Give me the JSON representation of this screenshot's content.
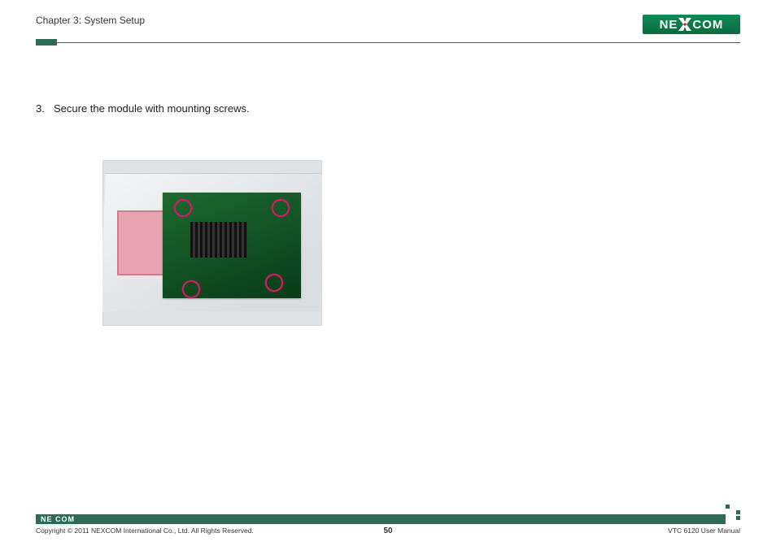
{
  "header": {
    "chapter": "Chapter 3: System Setup",
    "logo_text_left": "NE",
    "logo_text_right": "COM"
  },
  "body": {
    "step_number": "3.",
    "step_text": "Secure the module with mounting screws."
  },
  "footer": {
    "logo_text": "NE COM",
    "copyright": "Copyright © 2011 NEXCOM International Co., Ltd. All Rights Reserved.",
    "page_number": "50",
    "doc_title": "VTC 6120 User Manual"
  }
}
